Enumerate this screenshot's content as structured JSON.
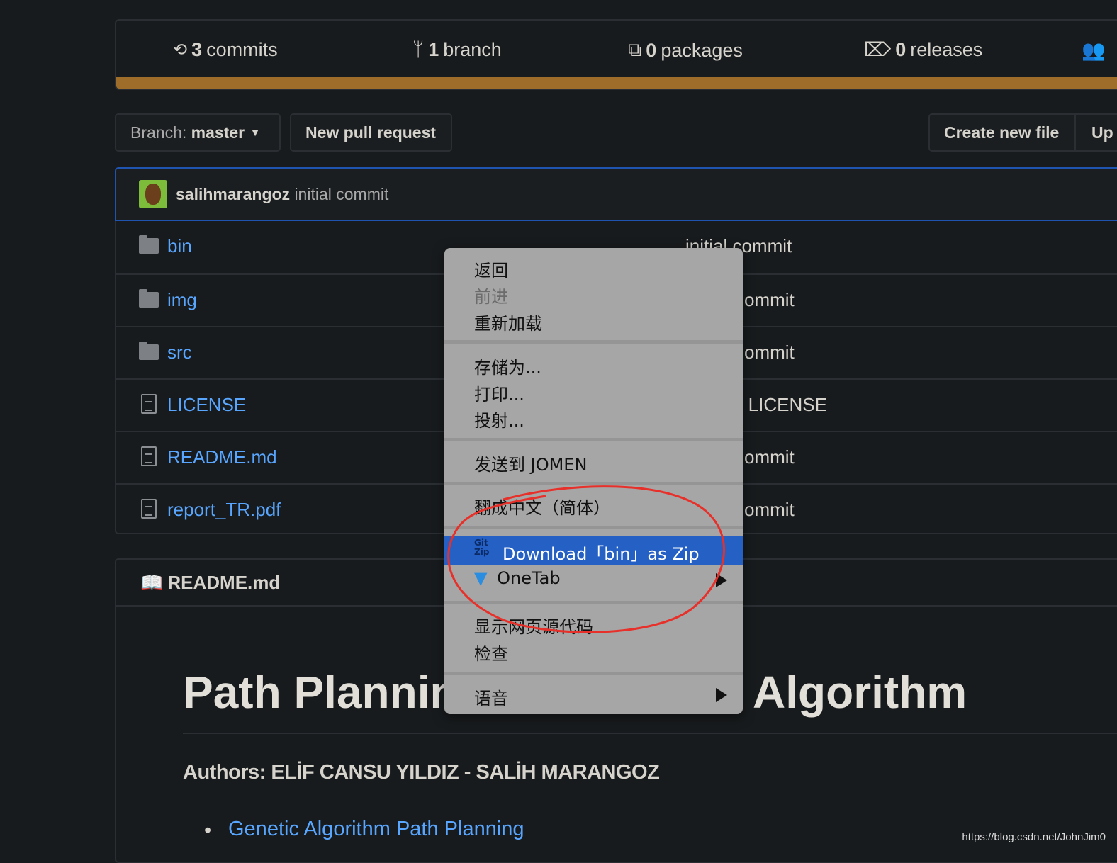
{
  "stats": {
    "commits": {
      "count": "3",
      "label": "commits"
    },
    "branches": {
      "count": "1",
      "label": "branch"
    },
    "packages": {
      "count": "0",
      "label": "packages"
    },
    "releases": {
      "count": "0",
      "label": "releases"
    }
  },
  "language_bar_color": "#9f6d2a",
  "toolbar": {
    "branch_prefix": "Branch:",
    "branch": "master",
    "new_pr": "New pull request",
    "create_file": "Create new file",
    "upload": "Up"
  },
  "latest_commit": {
    "author": "salihmarangoz",
    "message": "initial commit"
  },
  "files": [
    {
      "name": "bin",
      "type": "folder",
      "commit": "initial commit"
    },
    {
      "name": "img",
      "type": "folder",
      "commit": "ommit"
    },
    {
      "name": "src",
      "type": "folder",
      "commit": "ommit"
    },
    {
      "name": "LICENSE",
      "type": "file",
      "commit": "e LICENSE"
    },
    {
      "name": "README.md",
      "type": "file",
      "commit": "ommit"
    },
    {
      "name": "report_TR.pdf",
      "type": "file",
      "commit": "ommit"
    }
  ],
  "readme": {
    "header": "README.md",
    "title_left": "Path Plannin",
    "title_right": "Algorithm",
    "authors": "Authors: ELİF CANSU YILDIZ - SALİH MARANGOZ",
    "link": "Genetic Algorithm Path Planning"
  },
  "context_menu": {
    "back": "返回",
    "forward": "前进",
    "reload": "重新加载",
    "save_as": "存储为...",
    "print": "打印...",
    "cast": "投射...",
    "send_to": "发送到 JOMEN",
    "translate": "翻成中文（简体）",
    "gitzip": "Download「bin」as Zip",
    "gitzip_icon_text": "Git Zip",
    "onetab": "OneTab",
    "view_source": "显示网页源代码",
    "inspect": "检查",
    "speech": "语音",
    "highlight_color": "#2560c4"
  },
  "annotation_color": "#e8302a",
  "watermark": "https://blog.csdn.net/JohnJim0"
}
